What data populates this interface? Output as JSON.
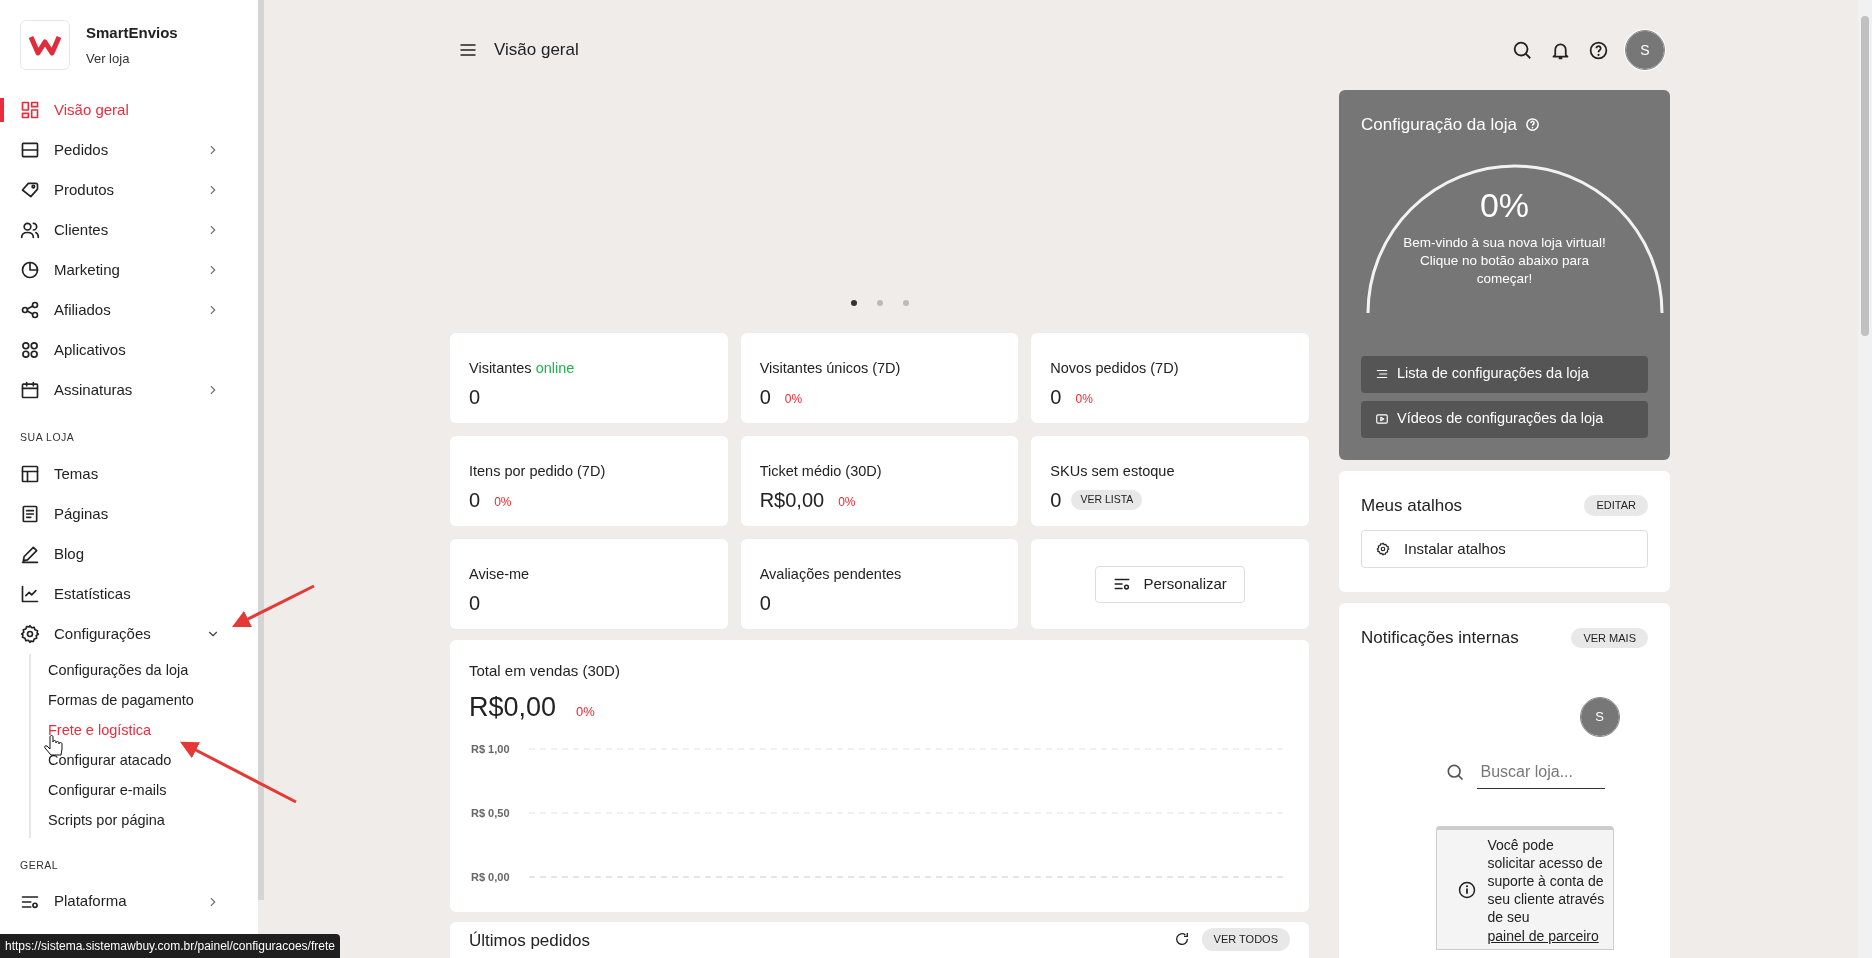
{
  "sidebar": {
    "store": {
      "name": "SmartEnvios",
      "link": "Ver loja"
    },
    "sections": [
      {
        "items": [
          {
            "label": "Visão geral",
            "selected": true,
            "expandable": false,
            "expanded": false
          },
          {
            "label": "Pedidos",
            "selected": false,
            "expandable": true,
            "expanded": false
          },
          {
            "label": "Produtos",
            "selected": false,
            "expandable": true,
            "expanded": false
          },
          {
            "label": "Clientes",
            "selected": false,
            "expandable": true,
            "expanded": false
          },
          {
            "label": "Marketing",
            "selected": false,
            "expandable": true,
            "expanded": false
          },
          {
            "label": "Afiliados",
            "selected": false,
            "expandable": true,
            "expanded": false
          },
          {
            "label": "Aplicativos",
            "selected": false,
            "expandable": false,
            "expanded": false
          },
          {
            "label": "Assinaturas",
            "selected": false,
            "expandable": true,
            "expanded": false
          }
        ]
      },
      {
        "heading": "SUA LOJA",
        "items": [
          {
            "label": "Temas",
            "selected": false,
            "expandable": false,
            "expanded": false
          },
          {
            "label": "Páginas",
            "selected": false,
            "expandable": false,
            "expanded": false
          },
          {
            "label": "Blog",
            "selected": false,
            "expandable": false,
            "expanded": false
          },
          {
            "label": "Estatísticas",
            "selected": false,
            "expandable": false,
            "expanded": false
          },
          {
            "label": "Configurações",
            "selected": false,
            "expandable": true,
            "expanded": true,
            "children": [
              {
                "label": "Configurações da loja",
                "selected": false
              },
              {
                "label": "Formas de pagamento",
                "selected": false
              },
              {
                "label": "Frete e logística",
                "selected": true
              },
              {
                "label": "Configurar atacado",
                "selected": false
              },
              {
                "label": "Configurar e-mails",
                "selected": false
              },
              {
                "label": "Scripts por página",
                "selected": false
              }
            ]
          }
        ]
      },
      {
        "heading": "GERAL",
        "items": [
          {
            "label": "Plataforma",
            "selected": false,
            "expandable": true,
            "expanded": false
          }
        ]
      }
    ]
  },
  "header": {
    "title": "Visão geral",
    "avatar": "S"
  },
  "carousel": {
    "dots": [
      {
        "selected": true
      },
      {
        "selected": false
      },
      {
        "selected": false
      }
    ]
  },
  "stats": [
    {
      "kind": "stat",
      "label": "Visitantes",
      "label_status": "online",
      "value": "0"
    },
    {
      "kind": "stat",
      "label": "Visitantes únicos (7D)",
      "value": "0",
      "change": "0%"
    },
    {
      "kind": "stat",
      "label": "Novos pedidos (7D)",
      "value": "0",
      "change": "0%"
    },
    {
      "kind": "stat",
      "label": "Itens por pedido (7D)",
      "value": "0",
      "change": "0%"
    },
    {
      "kind": "stat",
      "label": "Ticket médio (30D)",
      "value": "R$0,00",
      "change": "0%"
    },
    {
      "kind": "stat",
      "label": "SKUs sem estoque",
      "value": "0",
      "button": "VER LISTA"
    },
    {
      "kind": "stat",
      "label": "Avise-me",
      "value": "0"
    },
    {
      "kind": "stat",
      "label": "Avaliações pendentes",
      "value": "0"
    },
    {
      "kind": "action",
      "button": "Personalizar"
    }
  ],
  "sales": {
    "title": "Total em vendas (30D)",
    "value": "R$0,00",
    "change": "0%",
    "axis_labels": [
      "R$ 1,00",
      "R$ 0,50",
      "R$ 0,00"
    ]
  },
  "orders": {
    "title": "Últimos pedidos",
    "button": "VER TODOS"
  },
  "setup": {
    "title": "Configuração da loja",
    "percent": "0%",
    "message": "Bem-vindo à sua nova loja virtual! Clique no botão abaixo para começar!",
    "buttons": [
      "Lista de configurações da loja",
      "Vídeos de configurações da loja"
    ]
  },
  "shortcuts": {
    "title": "Meus atalhos",
    "button": "EDITAR",
    "items": [
      "Instalar atalhos"
    ]
  },
  "notifications": {
    "title": "Notificações internas",
    "button": "VER MAIS",
    "avatar": "S",
    "search": {
      "placeholder": "Buscar loja..."
    },
    "notice": {
      "text": "Você pode solicitar acesso de suporte à conta de seu cliente através de seu ",
      "link": "painel de parceiro"
    }
  },
  "status_url": "https://sistema.sistemawbuy.com.br/painel/configuracoes/frete"
}
